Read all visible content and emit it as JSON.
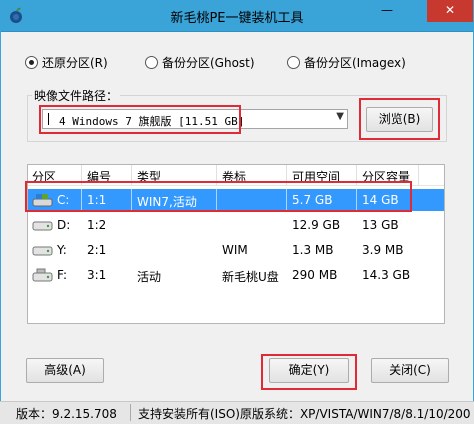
{
  "window": {
    "title": "新毛桃PE一键装机工具",
    "minimize": "—",
    "close": "✕"
  },
  "options": [
    {
      "label": "还原分区(R)",
      "selected": true
    },
    {
      "label": "备份分区(Ghost)",
      "selected": false
    },
    {
      "label": "备份分区(Imagex)",
      "selected": false
    }
  ],
  "image_path": {
    "label": "映像文件路径：",
    "value": "4 Windows 7 旗舰版 [11.51 GB]",
    "browse": "浏览(B)"
  },
  "table": {
    "columns": [
      "分区",
      "编号",
      "类型",
      "卷标",
      "可用空间",
      "分区容量"
    ],
    "rows": [
      {
        "drive": "C:",
        "num": "1:1",
        "type": "WIN7,活动",
        "label": "",
        "free": "5.7 GB",
        "size": "14 GB",
        "selected": true
      },
      {
        "drive": "D:",
        "num": "1:2",
        "type": "",
        "label": "",
        "free": "12.9 GB",
        "size": "13 GB",
        "selected": false
      },
      {
        "drive": "Y:",
        "num": "2:1",
        "type": "",
        "label": "WIM",
        "free": "1.3 MB",
        "size": "3.9 MB",
        "selected": false
      },
      {
        "drive": "F:",
        "num": "3:1",
        "type": "活动",
        "label": "新毛桃U盘",
        "free": "290 MB",
        "size": "14.3 GB",
        "selected": false
      }
    ]
  },
  "buttons": {
    "advanced": "高级(A)",
    "ok": "确定(Y)",
    "close": "关闭(C)"
  },
  "status": {
    "version": "版本：9.2.15.708",
    "note": "支持安装所有(ISO)原版系统：XP/VISTA/WIN7/8/8.1/10/200"
  },
  "colors": {
    "titlebar": "#3aa3d8",
    "selection": "#3399ff",
    "highlight_box": "#e02a36"
  }
}
